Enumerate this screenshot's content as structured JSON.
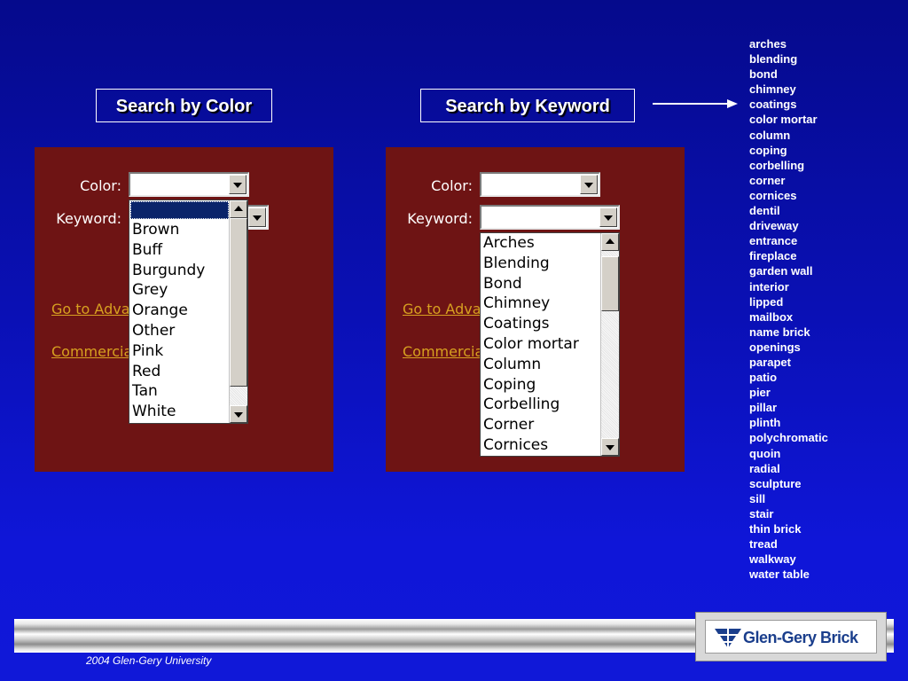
{
  "headings": {
    "color": "Search by Color",
    "keyword": "Search by Keyword"
  },
  "keyword_list": [
    "arches",
    "blending",
    "bond",
    "chimney",
    "coatings",
    "color mortar",
    "column",
    "coping",
    "corbelling",
    "corner",
    "cornices",
    "dentil",
    "driveway",
    "entrance",
    "fireplace",
    "garden wall",
    "interior",
    "lipped",
    "mailbox",
    "name brick",
    "openings",
    "parapet",
    "patio",
    "pier",
    "pillar",
    "plinth",
    "polychromatic",
    "quoin",
    "radial",
    "sculpture",
    "sill",
    "stair",
    "thin brick",
    "tread",
    "walkway",
    "water table"
  ],
  "form": {
    "color_label": "Color:",
    "keyword_label": "Keyword:",
    "advanced_link": "Go to Advar",
    "commercial_link": "Commercia"
  },
  "color_options": [
    "Brown",
    "Buff",
    "Burgundy",
    "Grey",
    "Orange",
    "Other",
    "Pink",
    "Red",
    "Tan",
    "White"
  ],
  "keyword_options": [
    "Arches",
    "Blending",
    "Bond",
    "Chimney",
    "Coatings",
    "Color mortar",
    "Column",
    "Coping",
    "Corbelling",
    "Corner",
    "Cornices"
  ],
  "footer": {
    "copyright": "2004 Glen-Gery University",
    "logo": "Glen-Gery Brick"
  },
  "colors": {
    "background": "#0a10b4",
    "panel": "#6e1414",
    "link": "#d7a020"
  }
}
